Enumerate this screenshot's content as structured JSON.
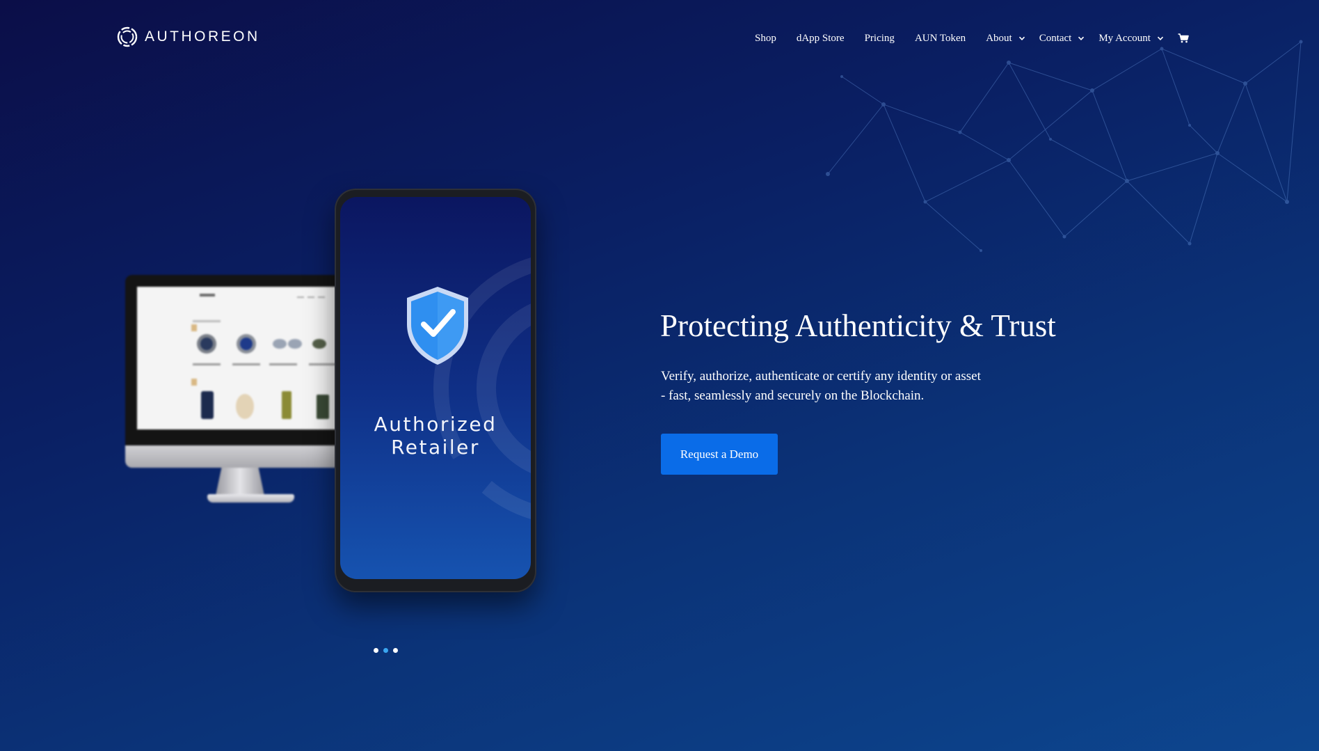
{
  "brand": {
    "name": "AUTHOREON",
    "logo_icon": "authoreon-ring-logo"
  },
  "nav": {
    "items": [
      {
        "label": "Shop",
        "has_dropdown": false
      },
      {
        "label": "dApp Store",
        "has_dropdown": false
      },
      {
        "label": "Pricing",
        "has_dropdown": false
      },
      {
        "label": "AUN Token",
        "has_dropdown": false
      },
      {
        "label": "About",
        "has_dropdown": true
      },
      {
        "label": "Contact",
        "has_dropdown": true
      },
      {
        "label": "My Account",
        "has_dropdown": true
      }
    ],
    "cart_icon": "shopping-cart-icon"
  },
  "hero": {
    "title": "Protecting Authenticity & Trust",
    "subtitle_line1": "Verify, authorize, authenticate or certify any identity or asset",
    "subtitle_line2": "- fast, seamlessly and securely on the Blockchain.",
    "cta_label": "Request a Demo",
    "phone_label_line1": "Authorized",
    "phone_label_line2": "Retailer",
    "shield_icon": "shield-check-icon"
  },
  "slider": {
    "dot_count": 3,
    "active_index": 1
  },
  "colors": {
    "background_start": "#0b0e48",
    "background_end": "#0d468f",
    "cta": "#0a6ce8",
    "active_dot": "#3aa6f0",
    "shield": "#2f8ff0"
  }
}
